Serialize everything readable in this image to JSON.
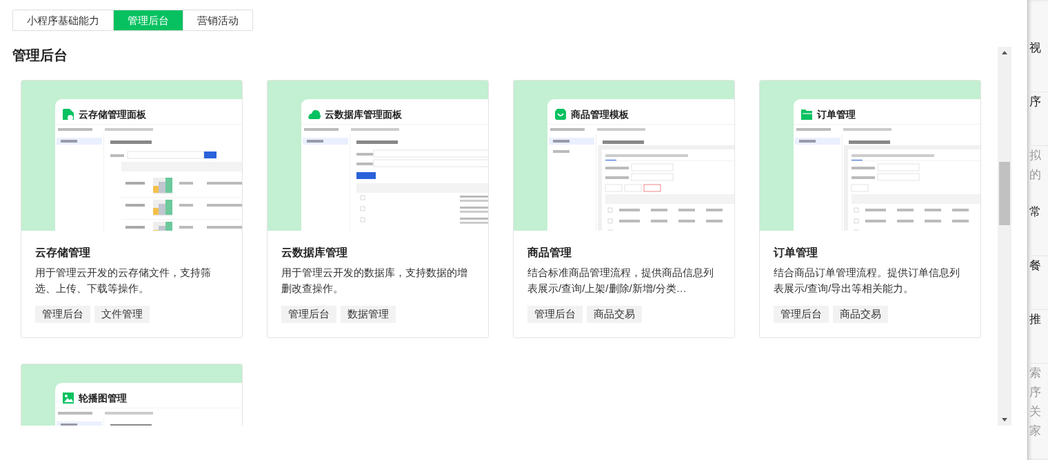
{
  "tabs": [
    {
      "label": "小程序基础能力",
      "selected": false
    },
    {
      "label": "管理后台",
      "selected": true
    },
    {
      "label": "营销活动",
      "selected": false
    }
  ],
  "section_title": "管理后台",
  "cards": [
    {
      "preview": {
        "title": "云存储管理面板",
        "kind": "storage"
      },
      "title": "云存储管理",
      "description": "用于管理云开发的云存储文件，支持筛选、上传、下载等操作。",
      "tags": [
        "管理后台",
        "文件管理"
      ]
    },
    {
      "preview": {
        "title": "云数据库管理面板",
        "kind": "database"
      },
      "title": "云数据库管理",
      "description": "用于管理云开发的数据库，支持数据的增删改查操作。",
      "tags": [
        "管理后台",
        "数据管理"
      ]
    },
    {
      "preview": {
        "title": "商品管理模板",
        "kind": "goods"
      },
      "title": "商品管理",
      "description": "结合标准商品管理流程，提供商品信息列表展示/查询/上架/删除/新增/分类…",
      "tags": [
        "管理后台",
        "商品交易"
      ]
    },
    {
      "preview": {
        "title": "订单管理",
        "kind": "orders"
      },
      "title": "订单管理",
      "description": "结合商品订单管理流程。提供订单信息列表展示/查询/导出等相关能力。",
      "tags": [
        "管理后台",
        "商品交易"
      ]
    },
    {
      "preview": {
        "title": "轮播图管理",
        "kind": "banner"
      }
    }
  ],
  "background_page": {
    "rows": [
      {
        "text": "视",
        "muted": false
      },
      {
        "text": "序",
        "muted": false
      },
      {
        "text": "拟",
        "muted": true
      },
      {
        "text": "的",
        "muted": true
      },
      {
        "text": "常",
        "muted": false
      },
      {
        "text": "餐",
        "muted": false
      },
      {
        "text": "推",
        "muted": false
      },
      {
        "text": "索",
        "muted": true
      },
      {
        "text": "序",
        "muted": true
      },
      {
        "text": "关",
        "muted": true
      },
      {
        "text": "家",
        "muted": true
      }
    ]
  }
}
